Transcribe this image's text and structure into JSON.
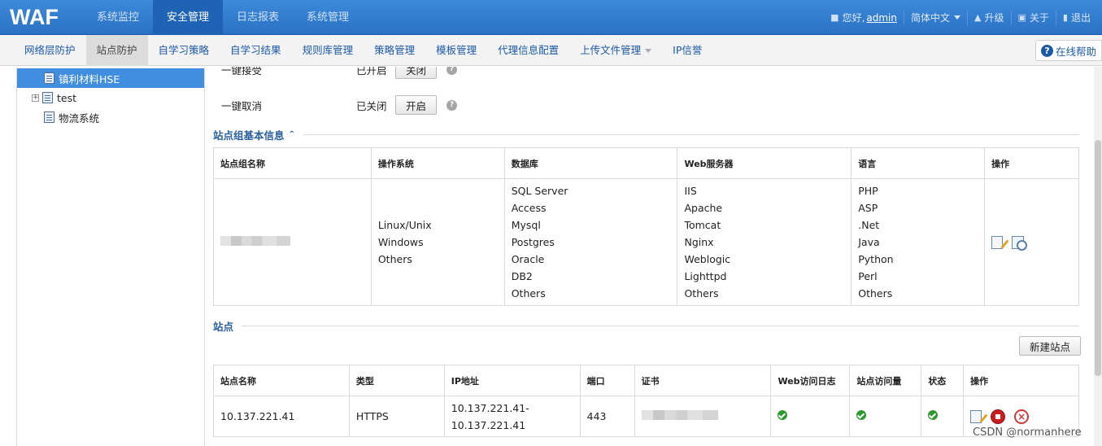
{
  "app": {
    "logo": "WAF"
  },
  "main_nav": [
    {
      "label": "系统监控",
      "active": false
    },
    {
      "label": "安全管理",
      "active": true
    },
    {
      "label": "日志报表",
      "active": false
    },
    {
      "label": "系统管理",
      "active": false
    }
  ],
  "user_bar": {
    "greeting": "您好,",
    "username": "admin",
    "language": "简体中文",
    "upgrade": "升级",
    "about": "关于",
    "logout": "退出"
  },
  "sub_nav": {
    "tabs": [
      {
        "label": "网络层防护",
        "active": false
      },
      {
        "label": "站点防护",
        "active": true
      },
      {
        "label": "自学习策略",
        "active": false
      },
      {
        "label": "自学习结果",
        "active": false
      },
      {
        "label": "规则库管理",
        "active": false
      },
      {
        "label": "策略管理",
        "active": false
      },
      {
        "label": "模板管理",
        "active": false
      },
      {
        "label": "代理信息配置",
        "active": false
      },
      {
        "label": "上传文件管理",
        "active": false,
        "dropdown": true
      },
      {
        "label": "IP信誉",
        "active": false
      }
    ],
    "help": "在线帮助"
  },
  "sidebar": {
    "items": [
      {
        "label": "镇利材料HSE",
        "selected": true,
        "expandable": false
      },
      {
        "label": "test",
        "selected": false,
        "expandable": true
      },
      {
        "label": "物流系统",
        "selected": false,
        "expandable": false
      }
    ]
  },
  "settings": {
    "rows": [
      {
        "label": "一键接受",
        "state": "已开启",
        "button": "关闭"
      },
      {
        "label": "一键取消",
        "state": "已关闭",
        "button": "开启"
      }
    ]
  },
  "group_section": {
    "title": "站点组基本信息",
    "headers": [
      "站点组名称",
      "操作系统",
      "数据库",
      "Web服务器",
      "语言",
      "操作"
    ],
    "row": {
      "os": [
        "Linux/Unix",
        "Windows",
        "Others"
      ],
      "db": [
        "SQL Server",
        "Access",
        "Mysql",
        "Postgres",
        "Oracle",
        "DB2",
        "Others"
      ],
      "web": [
        "IIS",
        "Apache",
        "Tomcat",
        "Nginx",
        "Weblogic",
        "Lighttpd",
        "Others"
      ],
      "lang": [
        "PHP",
        "ASP",
        ".Net",
        "Java",
        "Python",
        "Perl",
        "Others"
      ]
    }
  },
  "site_section": {
    "title": "站点",
    "new_button": "新建站点",
    "headers": [
      "站点名称",
      "类型",
      "IP地址",
      "端口",
      "证书",
      "Web访问日志",
      "站点访问量",
      "状态",
      "操作"
    ],
    "rows": [
      {
        "name": "10.137.221.41",
        "type": "HTTPS",
        "ip": "10.137.221.41-10.137.221.41",
        "port": "443"
      }
    ]
  },
  "watermark": "CSDN @normanhere",
  "colors": {
    "header": "#2a71c4",
    "active_nav": "#1f63b5",
    "selected_tree": "#3f8ee0",
    "link": "#1c5aa6"
  }
}
